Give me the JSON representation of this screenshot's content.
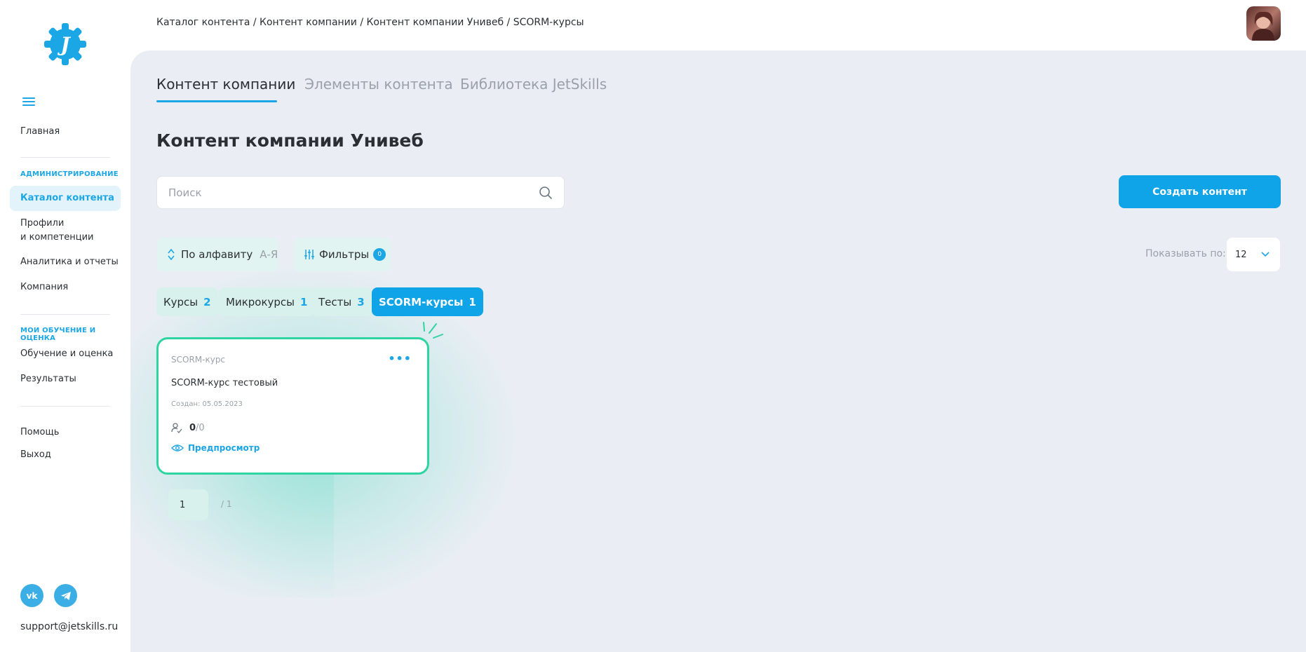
{
  "brand": {
    "logo_letter": "J",
    "accent": "#1ba6e6",
    "success": "#2ed4a2"
  },
  "breadcrumb": "Каталог контента / Контент компании / Контент компании Унивеб / SCORM-курсы",
  "sidebar": {
    "home": "Главная",
    "section_admin": "АДМИНИСТРИРОВАНИЕ",
    "catalog": "Каталог контента",
    "profiles_line1": "Профили",
    "profiles_line2": "и компетенции",
    "analytics": "Аналитика и отчеты",
    "company": "Компания",
    "section_learning": "МОИ ОБУЧЕНИЕ И ОЦЕНКА",
    "learning": "Обучение и оценка",
    "results": "Результаты",
    "help": "Помощь",
    "logout": "Выход",
    "support_email": "support@jetskills.ru",
    "social_vk": "vk-icon",
    "social_tg": "telegram-icon"
  },
  "tabs": [
    {
      "label": "Контент компании",
      "active": true
    },
    {
      "label": "Элементы контента",
      "active": false
    },
    {
      "label": "Библиотека JetSkills",
      "active": false
    }
  ],
  "page_title": "Контент компании Унивеб",
  "search": {
    "placeholder": "Поиск",
    "value": ""
  },
  "create_button": "Создать контент",
  "sort": {
    "label": "По алфавиту",
    "direction": "А-Я"
  },
  "filters": {
    "label": "Фильтры",
    "count": "0"
  },
  "show_by": {
    "label": "Показывать по:",
    "value": "12"
  },
  "chips": [
    {
      "label": "Курсы",
      "count": "2",
      "active": false
    },
    {
      "label": "Микрокурсы",
      "count": "1",
      "active": false
    },
    {
      "label": "Тесты",
      "count": "3",
      "active": false
    },
    {
      "label": "SCORM-курсы",
      "count": "1",
      "active": true
    }
  ],
  "cards": [
    {
      "type": "SCORM-курс",
      "title": "SCORM-курс тестовый",
      "created": "Создан: 05.05.2023",
      "users_done": "0",
      "users_total": "/0",
      "preview": "Предпросмотр"
    }
  ],
  "pagination": {
    "current": "1",
    "total": "/ 1"
  }
}
